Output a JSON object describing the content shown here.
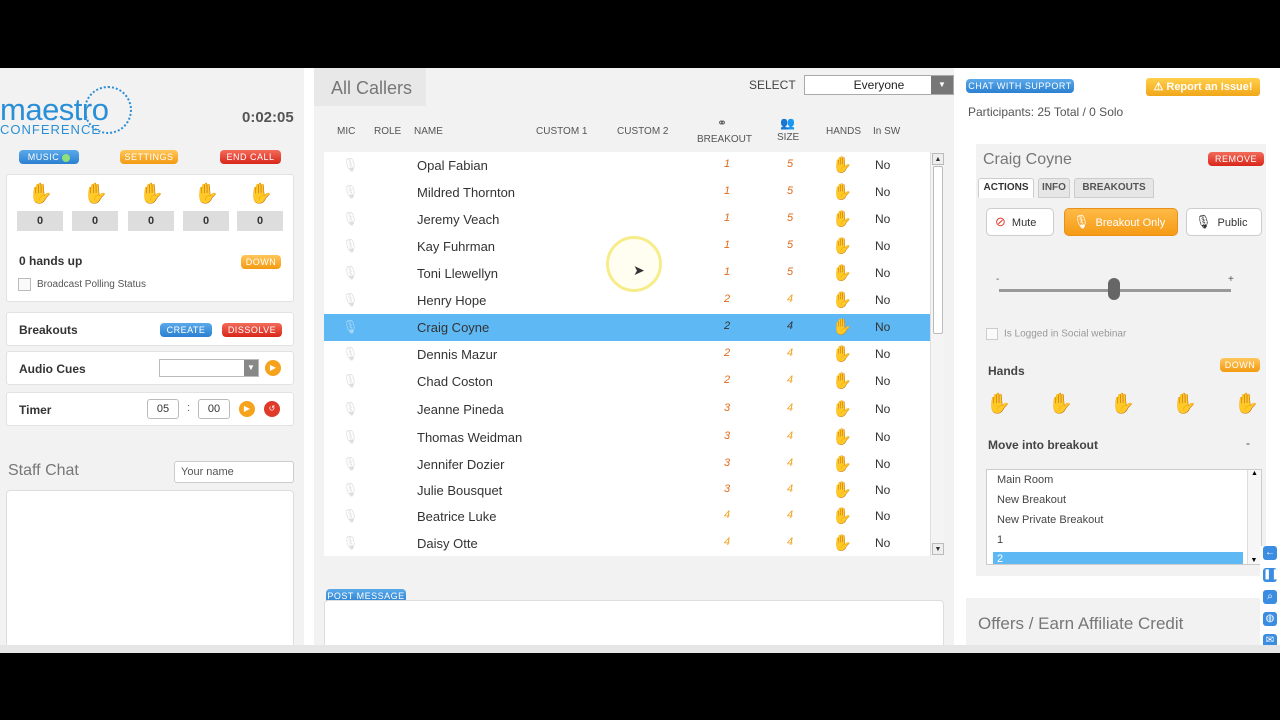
{
  "brand": {
    "line1": "maestro",
    "line2": "CONFERENCE"
  },
  "timer_display": "0:02:05",
  "top_buttons": {
    "music": "MUSIC",
    "settings": "SETTINGS",
    "end_call": "END CALL"
  },
  "hands_counts": [
    "0",
    "0",
    "0",
    "0",
    "0"
  ],
  "hands_up": "0 hands up",
  "down_label": "DOWN",
  "broadcast_polling": "Broadcast Polling Status",
  "breakouts": {
    "label": "Breakouts",
    "create": "CREATE",
    "dissolve": "DISSOLVE"
  },
  "audio_cues": {
    "label": "Audio Cues",
    "value": ""
  },
  "timer": {
    "label": "Timer",
    "minutes": "05",
    "sep": ":",
    "seconds": "00"
  },
  "staff_chat": {
    "title": "Staff Chat",
    "name_placeholder": "Your name"
  },
  "callers": {
    "title": "All Callers",
    "select_label": "SELECT",
    "select_value": "Everyone",
    "headers": {
      "mic": "MIC",
      "role": "ROLE",
      "name": "NAME",
      "custom1": "CUSTOM 1",
      "custom2": "CUSTOM 2",
      "breakout": "BREAKOUT",
      "size": "SIZE",
      "hands": "HANDS",
      "insw": "In SW"
    },
    "rows": [
      {
        "name": "Opal Fabian",
        "breakout": "1",
        "size": "5",
        "insw": "No"
      },
      {
        "name": "Mildred Thornton",
        "breakout": "1",
        "size": "5",
        "insw": "No"
      },
      {
        "name": "Jeremy Veach",
        "breakout": "1",
        "size": "5",
        "insw": "No"
      },
      {
        "name": "Kay Fuhrman",
        "breakout": "1",
        "size": "5",
        "insw": "No"
      },
      {
        "name": "Toni Llewellyn",
        "breakout": "1",
        "size": "5",
        "insw": "No"
      },
      {
        "name": "Henry Hope",
        "breakout": "2",
        "size": "4",
        "insw": "No"
      },
      {
        "name": "Craig Coyne",
        "breakout": "2",
        "size": "4",
        "insw": "No",
        "selected": true
      },
      {
        "name": "Dennis Mazur",
        "breakout": "2",
        "size": "4",
        "insw": "No"
      },
      {
        "name": "Chad Coston",
        "breakout": "2",
        "size": "4",
        "insw": "No"
      },
      {
        "name": "Jeanne Pineda",
        "breakout": "3",
        "size": "4",
        "insw": "No"
      },
      {
        "name": "Thomas Weidman",
        "breakout": "3",
        "size": "4",
        "insw": "No"
      },
      {
        "name": "Jennifer Dozier",
        "breakout": "3",
        "size": "4",
        "insw": "No"
      },
      {
        "name": "Julie Bousquet",
        "breakout": "3",
        "size": "4",
        "insw": "No"
      },
      {
        "name": "Beatrice Luke",
        "breakout": "4",
        "size": "4",
        "insw": "No"
      },
      {
        "name": "Daisy Otte",
        "breakout": "4",
        "size": "4",
        "insw": "No"
      }
    ]
  },
  "post_message": "POST MESSAGE",
  "right": {
    "chat_support": "CHAT WITH SUPPORT",
    "report_issue": "Report an Issue!",
    "participants": "Participants: 25 Total / 0 Solo",
    "selected_name": "Craig Coyne",
    "remove": "REMOVE",
    "tabs": [
      "ACTIONS",
      "INFO",
      "BREAKOUTS"
    ],
    "actions": {
      "mute": "Mute",
      "breakout_only": "Breakout Only",
      "public": "Public"
    },
    "volume_minus": "-",
    "volume_plus": "+",
    "logged_in": "Is Logged in Social webinar",
    "hands_label": "Hands",
    "down_label": "DOWN",
    "move_label": "Move into breakout",
    "move_toggle": "-",
    "breakout_list": [
      "Main Room",
      "New Breakout",
      "New Private Breakout",
      "1",
      "2"
    ],
    "offers": "Offers / Earn Affiliate Credit"
  },
  "colors": {
    "accent_blue": "#5db8f4",
    "orange": "#f7a21b",
    "red": "#e03a2a",
    "breakout_orange": "#e06a1b",
    "breakout_gold": "#f0a21b"
  }
}
